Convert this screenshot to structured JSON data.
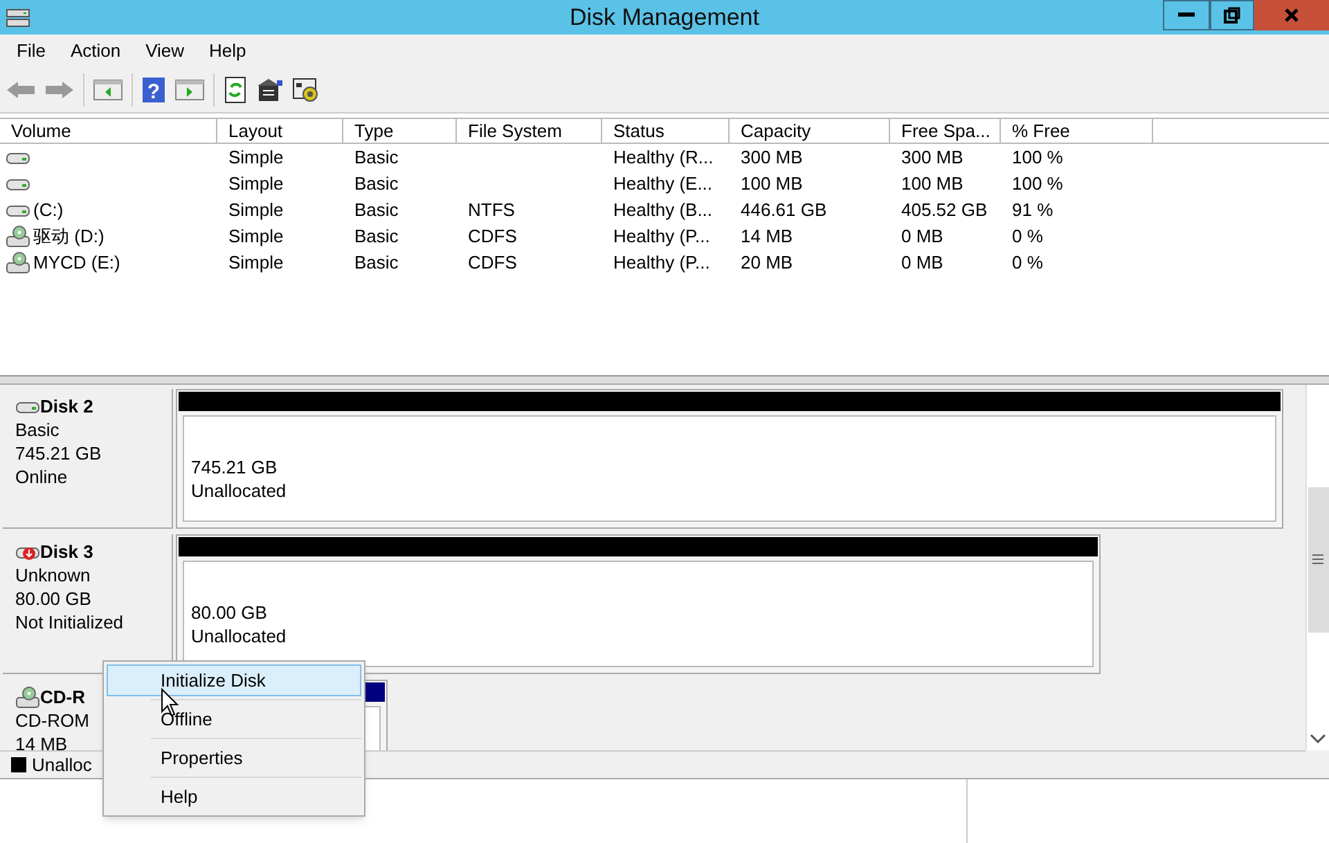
{
  "window": {
    "title": "Disk Management"
  },
  "menu": [
    "File",
    "Action",
    "View",
    "Help"
  ],
  "toolbar": {
    "help_glyph": "?"
  },
  "table": {
    "columns": [
      "Volume",
      "Layout",
      "Type",
      "File System",
      "Status",
      "Capacity",
      "Free Spa...",
      "% Free"
    ],
    "rows": [
      {
        "kind": "hdd",
        "cells": [
          "",
          "Simple",
          "Basic",
          "",
          "Healthy (R...",
          "300 MB",
          "300 MB",
          "100 %"
        ]
      },
      {
        "kind": "hdd",
        "cells": [
          "",
          "Simple",
          "Basic",
          "",
          "Healthy (E...",
          "100 MB",
          "100 MB",
          "100 %"
        ]
      },
      {
        "kind": "hdd",
        "cells": [
          "(C:)",
          "Simple",
          "Basic",
          "NTFS",
          "Healthy (B...",
          "446.61 GB",
          "405.52 GB",
          "91 %"
        ]
      },
      {
        "kind": "cd",
        "cells": [
          "驱动 (D:)",
          "Simple",
          "Basic",
          "CDFS",
          "Healthy (P...",
          "14 MB",
          "0 MB",
          "0 %"
        ]
      },
      {
        "kind": "cd",
        "cells": [
          "MYCD (E:)",
          "Simple",
          "Basic",
          "CDFS",
          "Healthy (P...",
          "20 MB",
          "0 MB",
          "0 %"
        ]
      }
    ]
  },
  "disks": [
    {
      "kind": "hdd",
      "name": "Disk 2",
      "lines": [
        "Basic",
        "745.21 GB",
        "Online"
      ],
      "partition": {
        "size": "745.21 GB",
        "label": "Unallocated",
        "color": "#000000"
      }
    },
    {
      "kind": "hdd-error",
      "name": "Disk 3",
      "lines": [
        "Unknown",
        "80.00 GB",
        "Not Initialized"
      ],
      "partition": {
        "size": "80.00 GB",
        "label": "Unallocated",
        "color": "#000000"
      }
    },
    {
      "kind": "cd",
      "name": "CD-R",
      "lines": [
        "CD-ROM",
        "14 MB"
      ],
      "partition": {
        "color": "#000080"
      }
    }
  ],
  "legend": [
    {
      "label": "Unalloc",
      "color": "#000000"
    }
  ],
  "context_menu": [
    {
      "label": "Initialize Disk",
      "selected": true
    },
    {
      "label": "Offline",
      "selected": false
    },
    {
      "label": "Properties",
      "selected": false
    },
    {
      "label": "Help",
      "selected": false
    }
  ]
}
